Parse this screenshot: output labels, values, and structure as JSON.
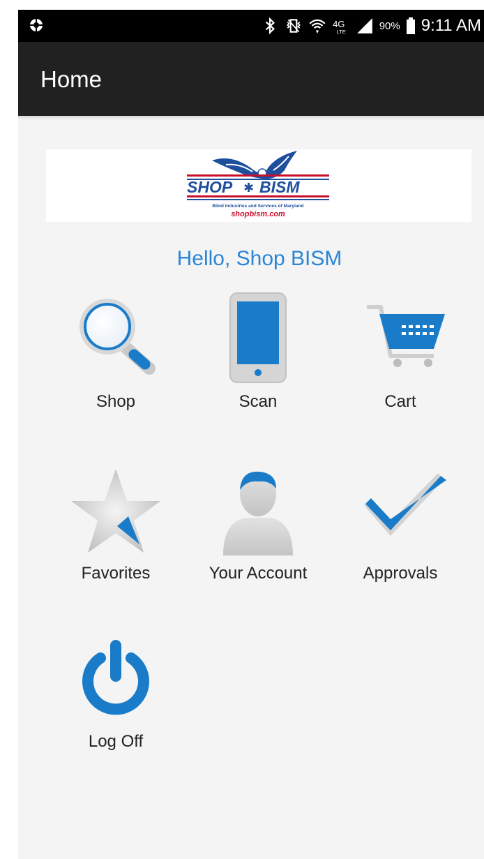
{
  "status_bar": {
    "battery_percent": "90%",
    "time": "9:11 AM",
    "icons": [
      "gear-icon",
      "bluetooth-icon",
      "vibrate-icon",
      "wifi-icon",
      "4g-lte-icon",
      "signal-icon",
      "battery-icon"
    ]
  },
  "app_bar": {
    "title": "Home"
  },
  "logo": {
    "brand_left": "SHOP",
    "brand_right": "BISM",
    "tagline": "Blind Industries and Services of Maryland",
    "url": "shopbism.com",
    "colors": {
      "blue": "#1f4e9c",
      "red": "#c8102e"
    }
  },
  "greeting": "Hello, Shop BISM",
  "menu": {
    "items": [
      {
        "label": "Shop",
        "icon": "magnifier-icon"
      },
      {
        "label": "Scan",
        "icon": "phone-icon"
      },
      {
        "label": "Cart",
        "icon": "cart-icon"
      },
      {
        "label": "Favorites",
        "icon": "star-icon"
      },
      {
        "label": "Your Account",
        "icon": "person-icon"
      },
      {
        "label": "Approvals",
        "icon": "checkmark-icon"
      },
      {
        "label": "Log Off",
        "icon": "power-icon"
      }
    ]
  },
  "colors": {
    "accent": "#2b85d6",
    "icon_blue": "#1a7cc9",
    "app_bar": "#212121"
  }
}
